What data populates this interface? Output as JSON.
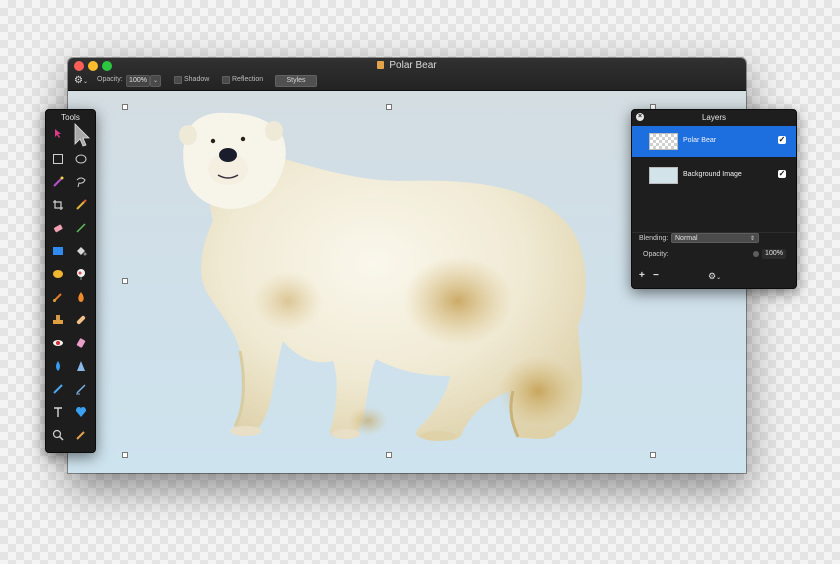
{
  "window": {
    "title": "Polar Bear",
    "toolbar": {
      "gear_menu": "gear-icon",
      "opacity_label": "Opacity:",
      "opacity_value": "100%",
      "shadow_label": "Shadow",
      "reflection_label": "Reflection",
      "styles_label": "Styles"
    }
  },
  "tools_panel": {
    "title": "Tools",
    "tools": [
      "arrow-icon",
      "pointer-icon",
      "rect-select-icon",
      "ellipse-select-icon",
      "magic-wand-icon",
      "lasso-icon",
      "crop-icon",
      "pen-icon",
      "eraser-icon",
      "line-icon",
      "rectangle-shape-icon",
      "paint-bucket-icon",
      "sponge-icon",
      "gradient-icon",
      "brush-icon",
      "burn-icon",
      "stamp-icon",
      "bandage-icon",
      "red-eye-icon",
      "smudge-icon",
      "blur-drop-icon",
      "sharpen-icon",
      "pencil-icon",
      "vector-pen-icon",
      "text-icon",
      "heart-shape-icon",
      "zoom-icon",
      "eyedropper-icon"
    ]
  },
  "layers_panel": {
    "title": "Layers",
    "layers": [
      {
        "name": "Polar Bear",
        "visible": true,
        "selected": true
      },
      {
        "name": "Background Image",
        "visible": true,
        "selected": false
      }
    ],
    "blending_label": "Blending:",
    "blending_value": "Normal",
    "opacity_label": "Opacity:",
    "opacity_value": "100%",
    "add_label": "+",
    "remove_label": "−"
  },
  "colors": {
    "accent": "#1d6fe0",
    "panel_bg": "#1e1e1e",
    "canvas_bg": "#d3e1e8"
  }
}
